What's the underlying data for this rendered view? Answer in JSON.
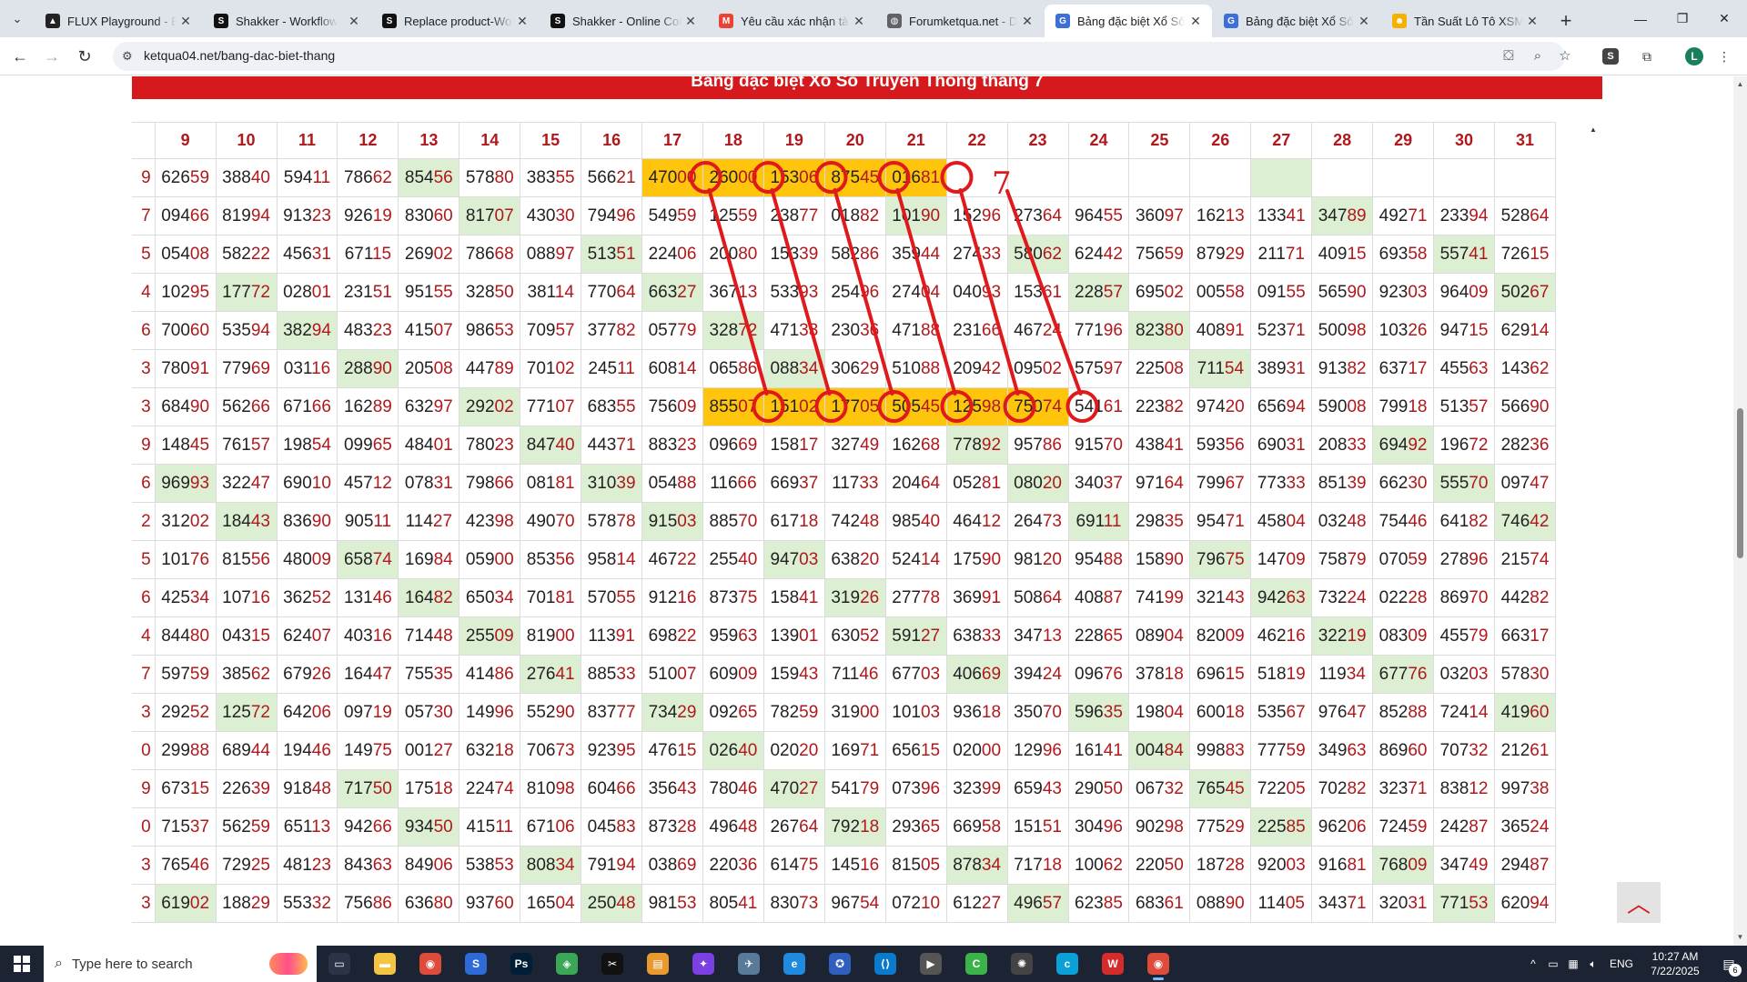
{
  "browser": {
    "tabs": [
      {
        "title": "FLUX Playground - Bl",
        "fav": "flux-icon",
        "fav_bg": "#222222",
        "fav_text": "▲"
      },
      {
        "title": "Shakker - Workflow",
        "fav": "shakker-icon",
        "fav_bg": "#111111",
        "fav_text": "S"
      },
      {
        "title": "Replace product-Wor",
        "fav": "shakker-icon",
        "fav_bg": "#111111",
        "fav_text": "S"
      },
      {
        "title": "Shakker - Online Con",
        "fav": "shakker-icon",
        "fav_bg": "#111111",
        "fav_text": "S"
      },
      {
        "title": "Yêu cầu xác nhận tài",
        "fav": "gmail-icon",
        "fav_bg": "#ea4335",
        "fav_text": "M"
      },
      {
        "title": "Forumketqua.net - D",
        "fav": "globe-icon",
        "fav_bg": "#5f6368",
        "fav_text": "◍"
      },
      {
        "title": "Bảng đặc biệt Xổ Số",
        "fav": "site-icon",
        "fav_bg": "#3d6fd8",
        "fav_text": "G",
        "active": true
      },
      {
        "title": "Bảng đặc biệt Xổ Số",
        "fav": "site-icon",
        "fav_bg": "#3d6fd8",
        "fav_text": "G"
      },
      {
        "title": "Tần Suất Lô Tô XSMB",
        "fav": "smiley-icon",
        "fav_bg": "#f3b100",
        "fav_text": "☻"
      }
    ],
    "url": "ketqua04.net/bang-dac-biet-thang",
    "profile_initial": "L"
  },
  "page": {
    "banner_title": "Bảng đặc biệt Xổ Số Truyền Thống tháng 7",
    "annotation_mark": "7",
    "day_headers": [
      "9",
      "10",
      "11",
      "12",
      "13",
      "14",
      "15",
      "16",
      "17",
      "18",
      "19",
      "20",
      "21",
      "22",
      "23",
      "24",
      "25",
      "26",
      "27",
      "28",
      "29",
      "30",
      "31"
    ],
    "first_column_tails": [
      "9",
      "7",
      "5",
      "4",
      "6",
      "3",
      "3",
      "9",
      "6",
      "2",
      "5",
      "6",
      "4",
      "7",
      "3",
      "0",
      "9",
      "0",
      "3",
      "3"
    ],
    "rows": [
      [
        "62659",
        "38840",
        "59411",
        "78662",
        "85456",
        "57880",
        "38355",
        "56621",
        "47000",
        "26000",
        "15306",
        "87545",
        "01681",
        "",
        "",
        "",
        "",
        "",
        "",
        "",
        "",
        "",
        ""
      ],
      [
        "09466",
        "81994",
        "91323",
        "92619",
        "83060",
        "81707",
        "43030",
        "79496",
        "54959",
        "12559",
        "23877",
        "01882",
        "10190",
        "15296",
        "27364",
        "96455",
        "36097",
        "16213",
        "13341",
        "34789",
        "49271",
        "23394",
        "52864"
      ],
      [
        "05408",
        "58222",
        "45631",
        "67115",
        "26902",
        "78668",
        "08897",
        "51351",
        "22406",
        "20080",
        "15339",
        "58286",
        "35944",
        "27433",
        "58062",
        "62442",
        "75659",
        "87929",
        "21171",
        "40915",
        "69358",
        "55741",
        "72615"
      ],
      [
        "10295",
        "17772",
        "02801",
        "23151",
        "95155",
        "32850",
        "38114",
        "77064",
        "66327",
        "36713",
        "53393",
        "25496",
        "27404",
        "04093",
        "15361",
        "22857",
        "69502",
        "00558",
        "09155",
        "56590",
        "92303",
        "96409",
        "50267"
      ],
      [
        "70060",
        "53594",
        "38294",
        "48323",
        "41507",
        "98653",
        "70957",
        "37782",
        "05779",
        "32872",
        "47133",
        "23036",
        "47188",
        "23166",
        "46724",
        "77196",
        "82380",
        "40891",
        "52371",
        "50098",
        "10326",
        "94715",
        "62914"
      ],
      [
        "78091",
        "77969",
        "03116",
        "28890",
        "20508",
        "44789",
        "70102",
        "24511",
        "60814",
        "06586",
        "08834",
        "30629",
        "51088",
        "20942",
        "09502",
        "57597",
        "22508",
        "71154",
        "38931",
        "91382",
        "63717",
        "45563",
        "14362"
      ],
      [
        "68490",
        "56266",
        "67166",
        "16289",
        "63297",
        "29202",
        "77107",
        "68355",
        "75609",
        "85507",
        "15102",
        "17705",
        "50545",
        "12598",
        "75074",
        "54161",
        "22382",
        "97420",
        "65694",
        "59008",
        "79918",
        "51357",
        "56690"
      ],
      [
        "14845",
        "76157",
        "19854",
        "09965",
        "48401",
        "78023",
        "84740",
        "44371",
        "88323",
        "09669",
        "15817",
        "32749",
        "16268",
        "77892",
        "95786",
        "91570",
        "43841",
        "59356",
        "69031",
        "20833",
        "69492",
        "19672",
        "28236"
      ],
      [
        "96993",
        "32247",
        "69010",
        "45712",
        "07831",
        "79866",
        "08181",
        "31039",
        "05488",
        "11666",
        "66937",
        "11733",
        "20464",
        "05281",
        "08020",
        "34037",
        "97164",
        "79967",
        "77333",
        "85139",
        "66230",
        "55570",
        "09747"
      ],
      [
        "31202",
        "18443",
        "83690",
        "90511",
        "11427",
        "42398",
        "49070",
        "57878",
        "91503",
        "88570",
        "61718",
        "74248",
        "98540",
        "46412",
        "26473",
        "69111",
        "29835",
        "95471",
        "45804",
        "03248",
        "75446",
        "64182",
        "74642"
      ],
      [
        "10176",
        "81556",
        "48009",
        "65874",
        "16984",
        "05900",
        "85356",
        "95814",
        "46722",
        "25540",
        "94703",
        "63820",
        "52414",
        "17590",
        "98120",
        "95488",
        "15890",
        "79675",
        "14709",
        "75879",
        "07059",
        "27896",
        "21574"
      ],
      [
        "42534",
        "10716",
        "36252",
        "13146",
        "16482",
        "65034",
        "70181",
        "57055",
        "91216",
        "87375",
        "15841",
        "31926",
        "27778",
        "36991",
        "50864",
        "40887",
        "74199",
        "32143",
        "94263",
        "73224",
        "02228",
        "86970",
        "44282"
      ],
      [
        "84480",
        "04315",
        "62407",
        "40316",
        "71448",
        "25509",
        "81900",
        "11391",
        "69822",
        "95963",
        "13901",
        "63052",
        "59127",
        "63833",
        "34713",
        "22865",
        "08904",
        "82009",
        "46216",
        "32219",
        "08309",
        "45579",
        "66317"
      ],
      [
        "59759",
        "38562",
        "67926",
        "16447",
        "75535",
        "41486",
        "27641",
        "88533",
        "51007",
        "60909",
        "15943",
        "71146",
        "67703",
        "40669",
        "39424",
        "09676",
        "37818",
        "69615",
        "51819",
        "11934",
        "67776",
        "03203",
        "57830"
      ],
      [
        "29252",
        "12572",
        "64206",
        "09719",
        "05730",
        "14996",
        "55290",
        "83777",
        "73429",
        "09265",
        "78259",
        "31900",
        "10103",
        "93618",
        "35070",
        "59635",
        "19804",
        "60018",
        "53567",
        "97647",
        "85288",
        "72414",
        "41960"
      ],
      [
        "29988",
        "68944",
        "19446",
        "14975",
        "00127",
        "63218",
        "70673",
        "92395",
        "47615",
        "02640",
        "02020",
        "16971",
        "65615",
        "02000",
        "12996",
        "16141",
        "00484",
        "99883",
        "77759",
        "34963",
        "86960",
        "70732",
        "21261"
      ],
      [
        "67315",
        "22639",
        "91848",
        "71750",
        "17518",
        "22474",
        "81098",
        "60466",
        "35643",
        "78046",
        "47027",
        "54179",
        "07396",
        "32399",
        "65943",
        "29050",
        "06732",
        "76545",
        "72205",
        "70282",
        "32371",
        "83812",
        "99738"
      ],
      [
        "71537",
        "56259",
        "65113",
        "94266",
        "93450",
        "41511",
        "67106",
        "04583",
        "87328",
        "49648",
        "26764",
        "79218",
        "29365",
        "66958",
        "15151",
        "30496",
        "90298",
        "77529",
        "22585",
        "96206",
        "72459",
        "24287",
        "36524"
      ],
      [
        "76546",
        "72925",
        "48123",
        "84363",
        "84906",
        "53853",
        "80834",
        "79194",
        "03869",
        "22036",
        "61475",
        "14516",
        "81505",
        "87834",
        "71718",
        "10062",
        "22050",
        "18728",
        "92003",
        "91681",
        "76809",
        "34749",
        "29487"
      ],
      [
        "61902",
        "18829",
        "55332",
        "75686",
        "63680",
        "93760",
        "16504",
        "25048",
        "98153",
        "80541",
        "83073",
        "96754",
        "07210",
        "61227",
        "49657",
        "62385",
        "68361",
        "08890",
        "11405",
        "34371",
        "32031",
        "77153",
        "62094"
      ]
    ],
    "green_cells": [
      [
        0,
        4
      ],
      [
        0,
        18
      ],
      [
        1,
        5
      ],
      [
        1,
        12
      ],
      [
        1,
        19
      ],
      [
        2,
        7
      ],
      [
        2,
        14
      ],
      [
        2,
        21
      ],
      [
        3,
        1
      ],
      [
        3,
        8
      ],
      [
        3,
        15
      ],
      [
        3,
        22
      ],
      [
        4,
        2
      ],
      [
        4,
        9
      ],
      [
        4,
        16
      ],
      [
        5,
        3
      ],
      [
        5,
        10
      ],
      [
        5,
        17
      ],
      [
        6,
        5
      ],
      [
        7,
        6
      ],
      [
        7,
        13
      ],
      [
        7,
        20
      ],
      [
        8,
        0
      ],
      [
        8,
        7
      ],
      [
        8,
        14
      ],
      [
        8,
        21
      ],
      [
        9,
        1
      ],
      [
        9,
        8
      ],
      [
        9,
        15
      ],
      [
        9,
        22
      ],
      [
        10,
        3
      ],
      [
        10,
        10
      ],
      [
        10,
        17
      ],
      [
        11,
        4
      ],
      [
        11,
        11
      ],
      [
        11,
        18
      ],
      [
        12,
        5
      ],
      [
        12,
        12
      ],
      [
        12,
        19
      ],
      [
        13,
        6
      ],
      [
        13,
        13
      ],
      [
        13,
        20
      ],
      [
        14,
        1
      ],
      [
        14,
        8
      ],
      [
        14,
        15
      ],
      [
        14,
        22
      ],
      [
        15,
        9
      ],
      [
        15,
        16
      ],
      [
        16,
        3
      ],
      [
        16,
        10
      ],
      [
        16,
        17
      ],
      [
        17,
        4
      ],
      [
        17,
        11
      ],
      [
        17,
        18
      ],
      [
        18,
        6
      ],
      [
        18,
        13
      ],
      [
        18,
        20
      ],
      [
        19,
        0
      ],
      [
        19,
        7
      ],
      [
        19,
        14
      ],
      [
        19,
        21
      ]
    ],
    "orange_cells": [
      [
        0,
        8
      ],
      [
        0,
        9
      ],
      [
        0,
        10
      ],
      [
        0,
        11
      ],
      [
        0,
        12
      ],
      [
        6,
        9
      ],
      [
        6,
        10
      ],
      [
        6,
        11
      ],
      [
        6,
        12
      ],
      [
        6,
        13
      ],
      [
        6,
        14
      ]
    ],
    "colors": {
      "accent": "#d6191c",
      "green": "#dcefd2",
      "orange": "#ffc40c",
      "annotation": "#e0191c"
    }
  },
  "taskbar": {
    "search_placeholder": "Type here to search",
    "apps": [
      "task-view-icon",
      "file-explorer-icon",
      "chrome-icon",
      "app-s-icon",
      "photoshop-icon",
      "app-green-icon",
      "capcut-icon",
      "app-folder-icon",
      "app-purple-icon",
      "app-bird-icon",
      "edge-icon",
      "app-star-icon",
      "vscode-icon",
      "app-video-icon",
      "app-green2-icon",
      "app-openai-icon",
      "app-c-icon",
      "app-w-icon",
      "chrome-icon-2"
    ],
    "lang": "ENG",
    "time": "10:27 AM",
    "date": "7/22/2025",
    "notification_count": "6"
  }
}
